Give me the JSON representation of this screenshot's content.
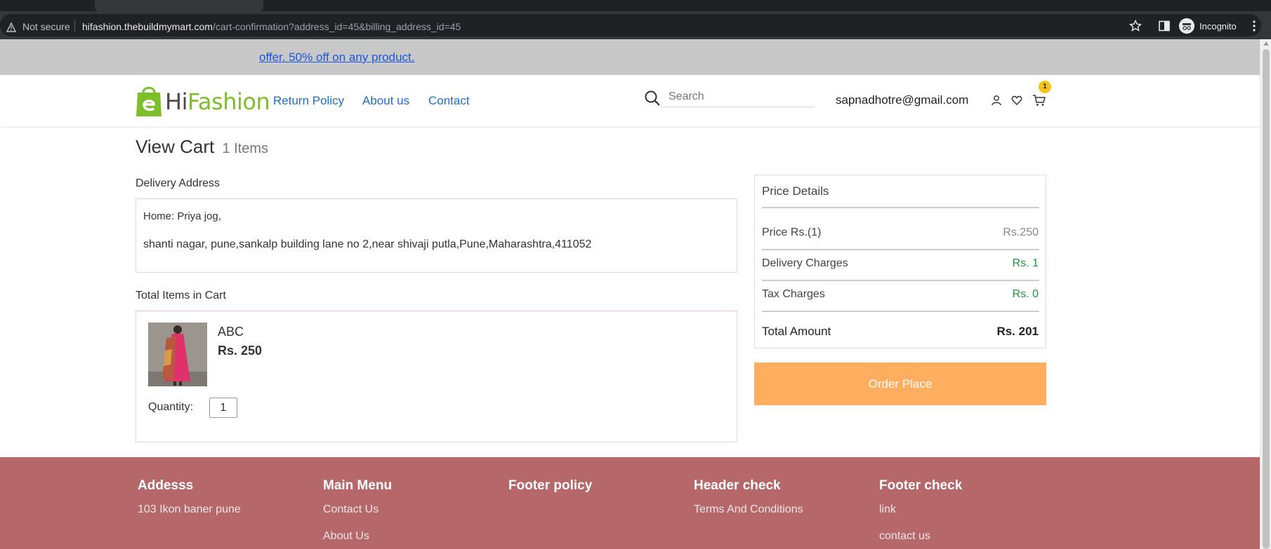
{
  "browser": {
    "security_label": "Not secure",
    "url_host": "hifashion.thebuildmymart.com",
    "url_path": "/cart-confirmation?address_id=45&billing_address_id=45",
    "profile_label": "Incognito"
  },
  "promo": {
    "text": "offer. 50% off on any product."
  },
  "header": {
    "brand_hi": "Hi",
    "brand_fashion": "Fashion",
    "nav": [
      "Return Policy",
      "About us",
      "Contact"
    ],
    "search_placeholder": "Search",
    "user_email": "sapnadhotre@gmail.com",
    "cart_count": "1"
  },
  "cart": {
    "title": "View Cart",
    "items_count": "1 Items",
    "delivery_address_label": "Delivery Address",
    "address_line1": "Home: Priya jog,",
    "address_line2": "shanti nagar, pune,sankalp building lane no 2,near shivaji putla,Pune,Maharashtra,411052",
    "items_label": "Total Items in Cart",
    "items": [
      {
        "name": "ABC",
        "price": "Rs. 250",
        "quantity_label": "Quantity:",
        "quantity": "1"
      }
    ]
  },
  "price_details": {
    "heading": "Price Details",
    "rows": [
      {
        "label": "Price Rs.(1)",
        "value": "Rs.250",
        "color": "#888888"
      },
      {
        "label": "Delivery Charges",
        "value": "Rs. 1",
        "color": "#1e9a3a"
      },
      {
        "label": "Tax Charges",
        "value": "Rs. 0",
        "color": "#1e9a3a"
      },
      {
        "label": "Total Amount",
        "value": "Rs. 201",
        "color": "#222222"
      }
    ],
    "order_button": "Order Place"
  },
  "footer": {
    "columns": [
      {
        "title": "Addesss",
        "links": [
          "103 Ikon baner pune"
        ]
      },
      {
        "title": "Main Menu",
        "links": [
          "Contact Us",
          "About Us"
        ]
      },
      {
        "title": "Footer policy",
        "links": []
      },
      {
        "title": "Header check",
        "links": [
          "Terms And Conditions"
        ]
      },
      {
        "title": "Footer check",
        "links": [
          "link",
          "contact us"
        ]
      }
    ]
  },
  "colors": {
    "accent_link": "#1a6fd1",
    "order_button": "#ffad5f",
    "footer_bg": "#b5676a",
    "brand_green": "#7cbf2a"
  }
}
